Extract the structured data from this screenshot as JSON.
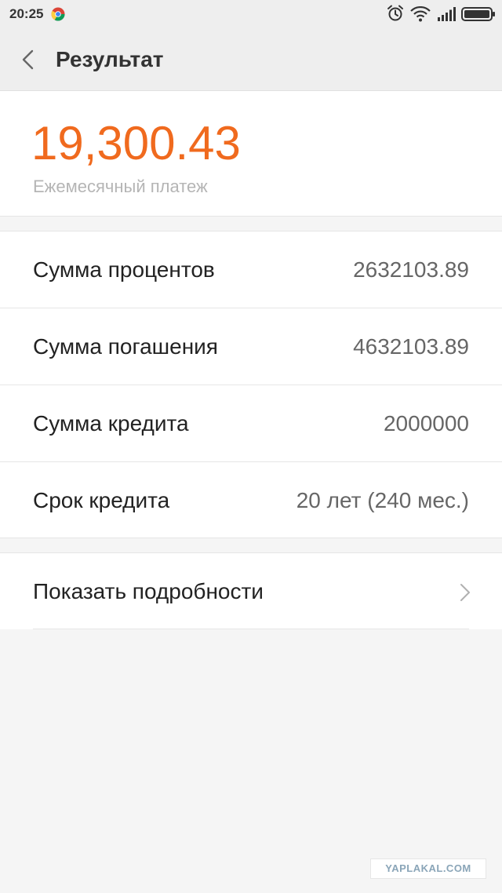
{
  "status_bar": {
    "time": "20:25",
    "icons": [
      "chrome-icon",
      "alarm-icon",
      "wifi-icon",
      "signal-icon",
      "battery-icon"
    ]
  },
  "app_bar": {
    "title": "Результат",
    "back_icon": "chevron-left-icon"
  },
  "summary": {
    "monthly_payment": "19,300.43",
    "monthly_payment_label": "Ежемесячный платеж"
  },
  "details": [
    {
      "label": "Сумма процентов",
      "value": "2632103.89"
    },
    {
      "label": "Сумма погашения",
      "value": "4632103.89"
    },
    {
      "label": "Сумма кредита",
      "value": "2000000"
    },
    {
      "label": "Срок кредита",
      "value": "20 лет (240 мес.)"
    }
  ],
  "more": {
    "label": "Показать подробности",
    "icon": "chevron-right-icon"
  },
  "watermark": "YAPLAKAL.COM",
  "colors": {
    "accent": "#f06a1e",
    "background": "#f5f5f5",
    "card": "#ffffff",
    "label_muted": "#b5b5b5"
  }
}
